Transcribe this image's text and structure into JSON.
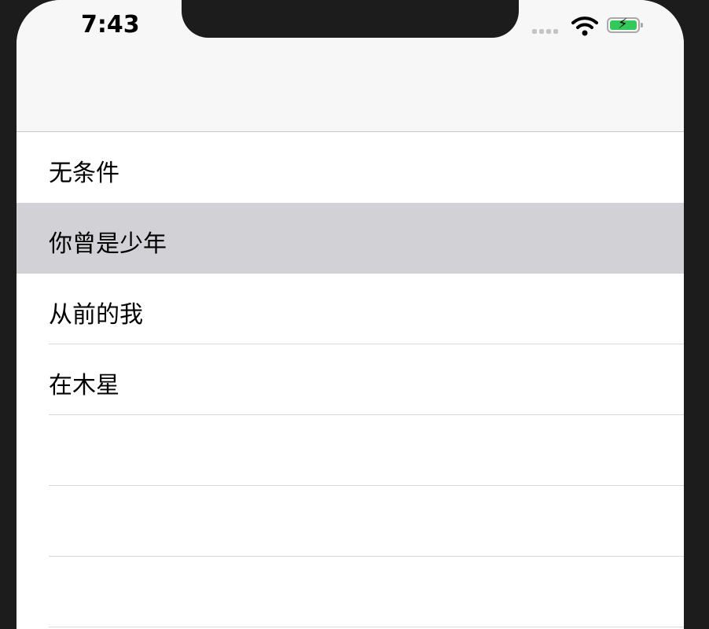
{
  "status_bar": {
    "time": "7:43",
    "battery_color": "#34c759"
  },
  "list": {
    "items": [
      {
        "label": "无条件",
        "selected": false
      },
      {
        "label": "你曾是少年",
        "selected": true
      },
      {
        "label": "从前的我",
        "selected": false
      },
      {
        "label": "在木星",
        "selected": false
      },
      {
        "label": "",
        "selected": false
      },
      {
        "label": "",
        "selected": false
      },
      {
        "label": "",
        "selected": false
      }
    ]
  }
}
